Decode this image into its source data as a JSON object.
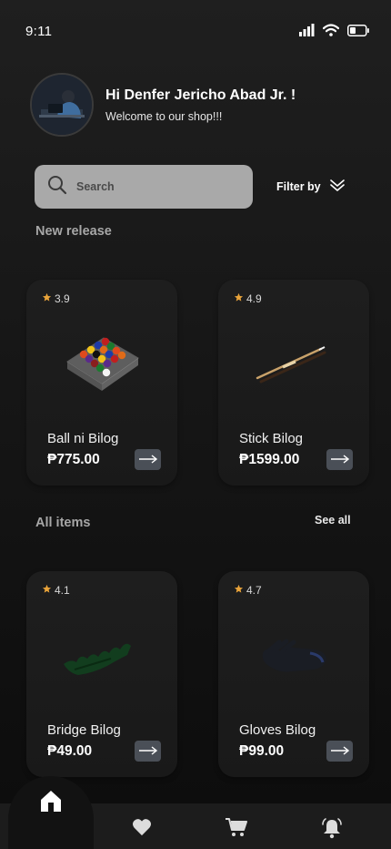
{
  "status_bar": {
    "time": "9:11",
    "icons": [
      "signal-icon",
      "wifi-icon",
      "battery-icon"
    ]
  },
  "header": {
    "greeting": "Hi Denfer Jericho Abad Jr. !",
    "welcome": "Welcome to our shop!!!"
  },
  "search": {
    "placeholder": "Search"
  },
  "filter": {
    "label": "Filter by"
  },
  "new_release": {
    "title": "New release",
    "items": [
      {
        "rating": "3.9",
        "name": "Ball ni Bilog",
        "price": "₱775.00",
        "image": "billiard-ball-set"
      },
      {
        "rating": "4.9",
        "name": "Stick Bilog",
        "price": "₱1599.00",
        "image": "cue-stick"
      }
    ]
  },
  "all_items": {
    "title": "All items",
    "see_all": "See all",
    "items": [
      {
        "rating": "4.1",
        "name": "Bridge Bilog",
        "price": "₱49.00",
        "image": "cue-bridge"
      },
      {
        "rating": "4.7",
        "name": "Gloves Bilog",
        "price": "₱99.00",
        "image": "billiard-glove"
      }
    ]
  },
  "nav": {
    "items": [
      "home-icon",
      "heart-icon",
      "cart-icon",
      "bell-icon"
    ],
    "active": "home-icon"
  },
  "colors": {
    "star": "#e8a33a",
    "button": "#4a4f57",
    "search_bg": "#a9a9a9"
  }
}
